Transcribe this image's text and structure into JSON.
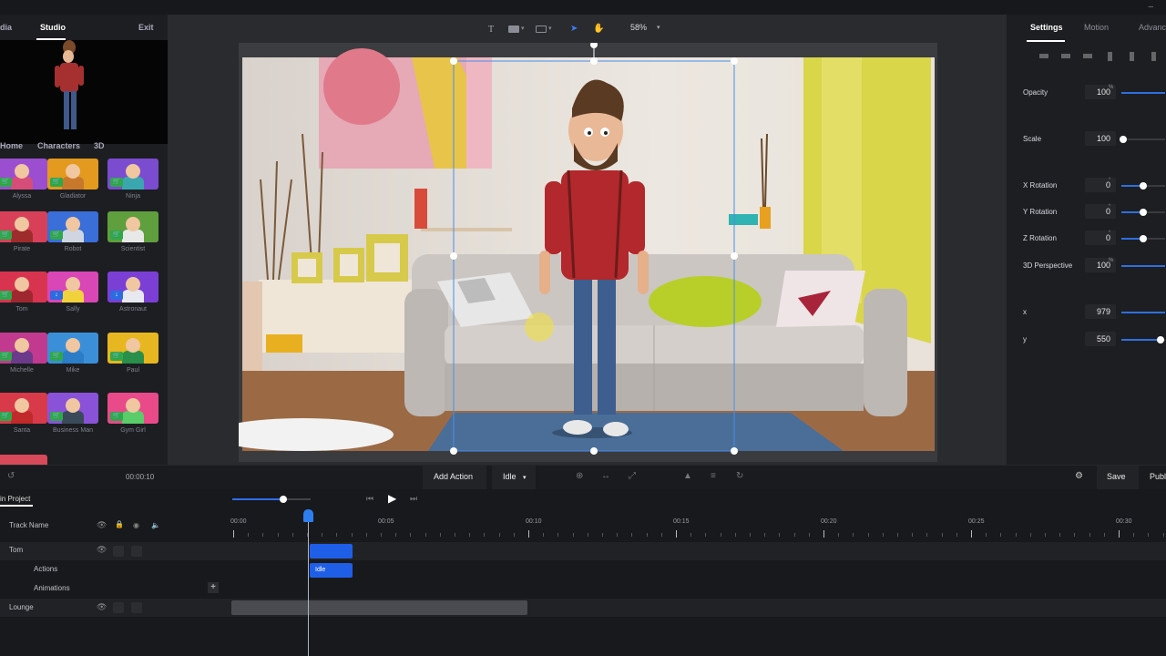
{
  "left_panel": {
    "tabs": [
      "dia",
      "Studio",
      "Exit"
    ],
    "categories": [
      "Home",
      "Characters",
      "3D"
    ],
    "characters": [
      {
        "name": "Alyssa",
        "color": "#9b4fd0",
        "body": "#d64d7a",
        "badge": "cart"
      },
      {
        "name": "Gladiator",
        "color": "#e39a1e",
        "body": "#c8782b",
        "badge": "cart"
      },
      {
        "name": "Ninja",
        "color": "#7b4ccf",
        "body": "#3aa7b0",
        "badge": "cart"
      },
      {
        "name": "Pirate",
        "color": "#d8405a",
        "body": "#9e2c2c",
        "badge": "cart"
      },
      {
        "name": "Robot",
        "color": "#3a6ed8",
        "body": "#cfd6e2",
        "badge": "cart"
      },
      {
        "name": "Scientist",
        "color": "#5f9f3e",
        "body": "#e8e8e8",
        "badge": "cart"
      },
      {
        "name": "Tom",
        "color": "#d9344f",
        "body": "#9e2730",
        "badge": "cart"
      },
      {
        "name": "Sally",
        "color": "#d946b6",
        "body": "#f2d23c",
        "badge": "download"
      },
      {
        "name": "Astronaut",
        "color": "#7b3fd6",
        "body": "#e8e8f0",
        "badge": "download"
      },
      {
        "name": "Michelle",
        "color": "#c13a8f",
        "body": "#6b3a8a",
        "badge": "cart"
      },
      {
        "name": "Mike",
        "color": "#3a8fd8",
        "body": "#2c7dc8",
        "badge": "cart"
      },
      {
        "name": "Paul",
        "color": "#e8b620",
        "body": "#2a8f4a",
        "badge": "cart"
      },
      {
        "name": "Santa",
        "color": "#d83a4a",
        "body": "#c02a2a",
        "badge": "cart"
      },
      {
        "name": "Business Man",
        "color": "#8a52d8",
        "body": "#3a4a5a",
        "badge": "cart"
      },
      {
        "name": "Gym Girl",
        "color": "#e84a8a",
        "body": "#5acc6a",
        "badge": "cart"
      }
    ]
  },
  "toolbar": {
    "zoom": "58%"
  },
  "right_panel": {
    "tabs": [
      "Settings",
      "Motion",
      "Advanc"
    ],
    "properties": [
      {
        "label": "Opacity",
        "value": "100",
        "unit": "%",
        "level": 1.0
      },
      {
        "label": "Scale",
        "value": "100",
        "unit": "",
        "level": 0.05
      },
      {
        "label": "X Rotation",
        "value": "0",
        "unit": "°",
        "level": 0.5
      },
      {
        "label": "Y Rotation",
        "value": "0",
        "unit": "°",
        "level": 0.5
      },
      {
        "label": "Z Rotation",
        "value": "0",
        "unit": "°",
        "level": 0.5
      },
      {
        "label": "3D Perspective",
        "value": "100",
        "unit": "%",
        "level": 1.0
      },
      {
        "label": "x",
        "value": "979",
        "unit": "",
        "level": 1.0
      },
      {
        "label": "y",
        "value": "550",
        "unit": "",
        "level": 0.9
      }
    ]
  },
  "action_bar": {
    "time": "00:00:10",
    "add_action": "Add Action",
    "action_select": "Idle",
    "save": "Save",
    "publish": "Publ"
  },
  "timeline": {
    "project_label": "in Project",
    "track_name_header": "Track Name",
    "ticks": [
      "00:00",
      "00:05",
      "00:10",
      "00:15",
      "00:20",
      "00:25",
      "00:30"
    ],
    "tracks": [
      {
        "name": "Tom"
      },
      {
        "name": "Actions"
      },
      {
        "name": "Animations"
      },
      {
        "name": "Lounge"
      }
    ],
    "clip_idle": "Idle"
  },
  "colors": {
    "accent": "#2d6ff0",
    "clip": "#1f5fe8"
  }
}
